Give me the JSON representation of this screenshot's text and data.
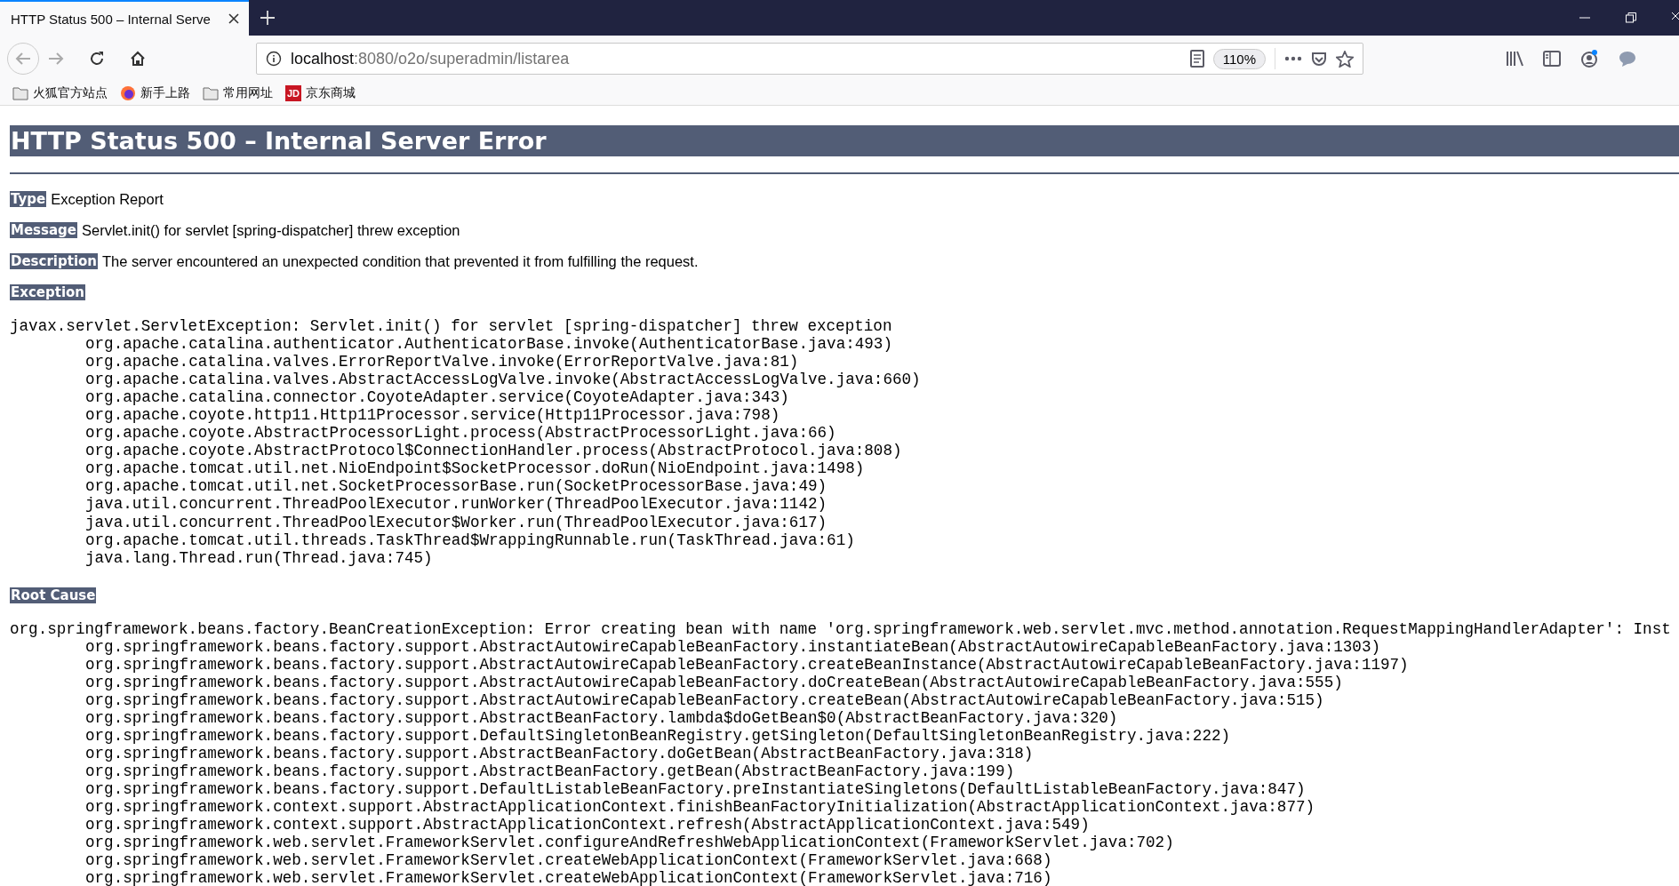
{
  "browser": {
    "tabs": [
      {
        "title": "HTTP Status 500 – Internal Serve",
        "selected": true
      }
    ],
    "url": {
      "host": "localhost",
      "rest": ":8080/o2o/superadmin/listarea"
    },
    "zoom": "110%",
    "bookmarks": [
      {
        "label": "火狐官方站点",
        "kind": "folder"
      },
      {
        "label": "新手上路",
        "kind": "firefox"
      },
      {
        "label": "常用网址",
        "kind": "folder"
      },
      {
        "label": "京东商城",
        "kind": "jd",
        "icon_text": "JD"
      }
    ]
  },
  "page": {
    "title": "HTTP Status 500 – Internal Server Error",
    "fields": [
      {
        "label": "Type",
        "value": "Exception Report"
      },
      {
        "label": "Message",
        "value": "Servlet.init() for servlet [spring-dispatcher] threw exception"
      },
      {
        "label": "Description",
        "value": "The server encountered an unexpected condition that prevented it from fulfilling the request."
      }
    ],
    "exception": {
      "label": "Exception",
      "message": "javax.servlet.ServletException: Servlet.init() for servlet [spring-dispatcher] threw exception",
      "frames": [
        "org.apache.catalina.authenticator.AuthenticatorBase.invoke(AuthenticatorBase.java:493)",
        "org.apache.catalina.valves.ErrorReportValve.invoke(ErrorReportValve.java:81)",
        "org.apache.catalina.valves.AbstractAccessLogValve.invoke(AbstractAccessLogValve.java:660)",
        "org.apache.catalina.connector.CoyoteAdapter.service(CoyoteAdapter.java:343)",
        "org.apache.coyote.http11.Http11Processor.service(Http11Processor.java:798)",
        "org.apache.coyote.AbstractProcessorLight.process(AbstractProcessorLight.java:66)",
        "org.apache.coyote.AbstractProtocol$ConnectionHandler.process(AbstractProtocol.java:808)",
        "org.apache.tomcat.util.net.NioEndpoint$SocketProcessor.doRun(NioEndpoint.java:1498)",
        "org.apache.tomcat.util.net.SocketProcessorBase.run(SocketProcessorBase.java:49)",
        "java.util.concurrent.ThreadPoolExecutor.runWorker(ThreadPoolExecutor.java:1142)",
        "java.util.concurrent.ThreadPoolExecutor$Worker.run(ThreadPoolExecutor.java:617)",
        "org.apache.tomcat.util.threads.TaskThread$WrappingRunnable.run(TaskThread.java:61)",
        "java.lang.Thread.run(Thread.java:745)"
      ]
    },
    "root_cause": {
      "label": "Root Cause",
      "message": "org.springframework.beans.factory.BeanCreationException: Error creating bean with name 'org.springframework.web.servlet.mvc.method.annotation.RequestMappingHandlerAdapter': Inst",
      "frames": [
        "org.springframework.beans.factory.support.AbstractAutowireCapableBeanFactory.instantiateBean(AbstractAutowireCapableBeanFactory.java:1303)",
        "org.springframework.beans.factory.support.AbstractAutowireCapableBeanFactory.createBeanInstance(AbstractAutowireCapableBeanFactory.java:1197)",
        "org.springframework.beans.factory.support.AbstractAutowireCapableBeanFactory.doCreateBean(AbstractAutowireCapableBeanFactory.java:555)",
        "org.springframework.beans.factory.support.AbstractAutowireCapableBeanFactory.createBean(AbstractAutowireCapableBeanFactory.java:515)",
        "org.springframework.beans.factory.support.AbstractBeanFactory.lambda$doGetBean$0(AbstractBeanFactory.java:320)",
        "org.springframework.beans.factory.support.DefaultSingletonBeanRegistry.getSingleton(DefaultSingletonBeanRegistry.java:222)",
        "org.springframework.beans.factory.support.AbstractBeanFactory.doGetBean(AbstractBeanFactory.java:318)",
        "org.springframework.beans.factory.support.AbstractBeanFactory.getBean(AbstractBeanFactory.java:199)",
        "org.springframework.beans.factory.support.DefaultListableBeanFactory.preInstantiateSingletons(DefaultListableBeanFactory.java:847)",
        "org.springframework.context.support.AbstractApplicationContext.finishBeanFactoryInitialization(AbstractApplicationContext.java:877)",
        "org.springframework.context.support.AbstractApplicationContext.refresh(AbstractApplicationContext.java:549)",
        "org.springframework.web.servlet.FrameworkServlet.configureAndRefreshWebApplicationContext(FrameworkServlet.java:702)",
        "org.springframework.web.servlet.FrameworkServlet.createWebApplicationContext(FrameworkServlet.java:668)",
        "org.springframework.web.servlet.FrameworkServlet.createWebApplicationContext(FrameworkServlet.java:716)"
      ]
    }
  }
}
